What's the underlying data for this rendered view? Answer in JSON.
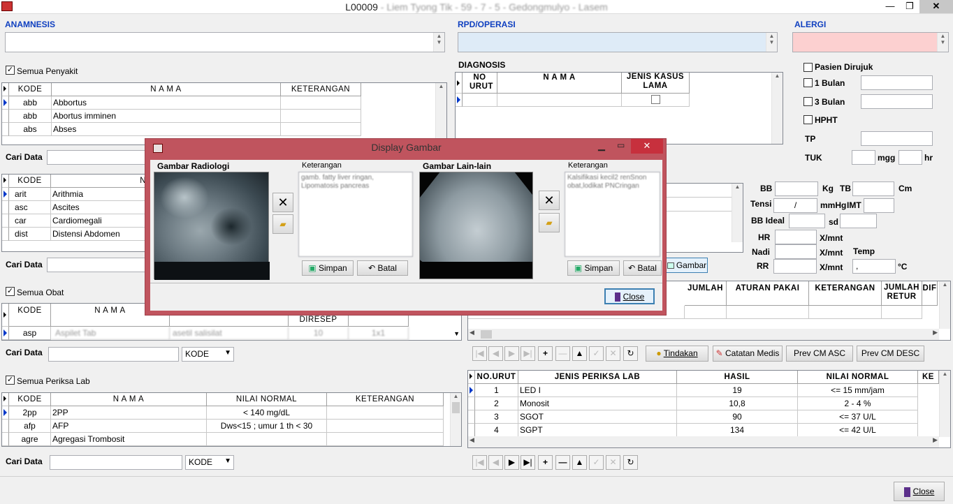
{
  "window": {
    "title_code": "L00009",
    "title_sep1": " - ",
    "title_blur": "Liem Tyong Tik - 59 - 7 - 5 - Gedongmulyo - Lasem"
  },
  "anamnesis": {
    "label": "ANAMNESIS"
  },
  "rpd": {
    "label": "RPD/OPERASI"
  },
  "alergi": {
    "label": "ALERGI"
  },
  "penyakit": {
    "check_label": "Semua Penyakit",
    "cols": [
      "KODE",
      "N A M A",
      "KETERANGAN"
    ],
    "rows": [
      [
        "abb",
        "Abbortus",
        ""
      ],
      [
        "abb",
        "Abortus imminen",
        ""
      ],
      [
        "abs",
        "Abses",
        ""
      ]
    ],
    "cari": "Cari Data"
  },
  "diagnosis": {
    "label": "DIAGNOSIS",
    "cols": [
      "NO URUT",
      "N A M A",
      "JENIS KASUS LAMA"
    ]
  },
  "rujuk": {
    "pasien_dirujuk": "Pasien Dirujuk",
    "bulan1": "1 Bulan",
    "bulan3": "3 Bulan",
    "hpht": "HPHT",
    "tp": "TP",
    "tuk": "TUK",
    "mgg": "mgg",
    "hr": "hr"
  },
  "gejala": {
    "cols": [
      "KODE",
      "N A M A"
    ],
    "rows": [
      [
        "arit",
        "Arithmia"
      ],
      [
        "asc",
        "Ascites"
      ],
      [
        "car",
        "Cardiomegali"
      ],
      [
        "dist",
        "Distensi Abdomen"
      ]
    ],
    "cari": "Cari Data"
  },
  "vitals": {
    "bb": "BB",
    "kg": "Kg",
    "tb": "TB",
    "cm": "Cm",
    "tensi": "Tensi",
    "tensi_val": "/",
    "mmhg": "mmHg",
    "imt": "IMT",
    "bb_ideal": "BB Ideal",
    "sd": "sd",
    "hr": "HR",
    "xmnt": "X/mnt",
    "nadi": "Nadi",
    "temp": "Temp",
    "rr": "RR",
    "temp_val": ",",
    "c": "°C"
  },
  "gambar_btn": "Gambar",
  "obat": {
    "check_label": "Semua Obat",
    "cols": [
      "KODE",
      "N A M A",
      "DIRESEP"
    ],
    "row_kode": "asp",
    "row_nama": "Aspilet Tab",
    "row_ket": "asetil salisilat",
    "row_jml": "10",
    "row_aturan": "1x1",
    "cari": "Cari Data",
    "filter": "KODE"
  },
  "resep": {
    "cols": [
      "JUMLAH",
      "ATURAN PAKAI",
      "KETERANGAN",
      "JUMLAH RETUR",
      "DIF"
    ]
  },
  "actions": {
    "tindakan": "Tindakan",
    "catatan": "Catatan Medis",
    "prev_asc": "Prev CM ASC",
    "prev_desc": "Prev CM DESC"
  },
  "lab": {
    "check_label": "Semua Periksa Lab",
    "cols": [
      "KODE",
      "N A M A",
      "NILAI NORMAL",
      "KETERANGAN"
    ],
    "rows": [
      [
        "2pp",
        "2PP",
        "< 140 mg/dL",
        ""
      ],
      [
        "afp",
        "AFP",
        "Dws<15 ; umur 1 th < 30",
        ""
      ],
      [
        "agre",
        "Agregasi Trombosit",
        "",
        ""
      ]
    ],
    "cari": "Cari Data",
    "filter": "KODE"
  },
  "hasil_lab": {
    "cols": [
      "NO.URUT",
      "JENIS PERIKSA LAB",
      "HASIL",
      "NILAI NORMAL",
      "KE"
    ],
    "rows": [
      [
        "1",
        "LED I",
        "19",
        "<= 15 mm/jam"
      ],
      [
        "2",
        "Monosit",
        "10,8",
        "2 - 4 %"
      ],
      [
        "3",
        "SGOT",
        "90",
        "<= 37 U/L"
      ],
      [
        "4",
        "SGPT",
        "134",
        "<= 42 U/L"
      ]
    ]
  },
  "close": "Close",
  "dialog": {
    "title": "Display Gambar",
    "radiologi": "Gambar Radiologi",
    "lain": "Gambar Lain-lain",
    "keterangan": "Keterangan",
    "ket1": "gamb. fatty liver ringan, Lipomatosis pancreas",
    "ket2": "Kalsifikasi kecil2 renSnon obat,lodikat PNCringan",
    "simpan": "Simpan",
    "batal": "Batal",
    "close": "Close"
  }
}
